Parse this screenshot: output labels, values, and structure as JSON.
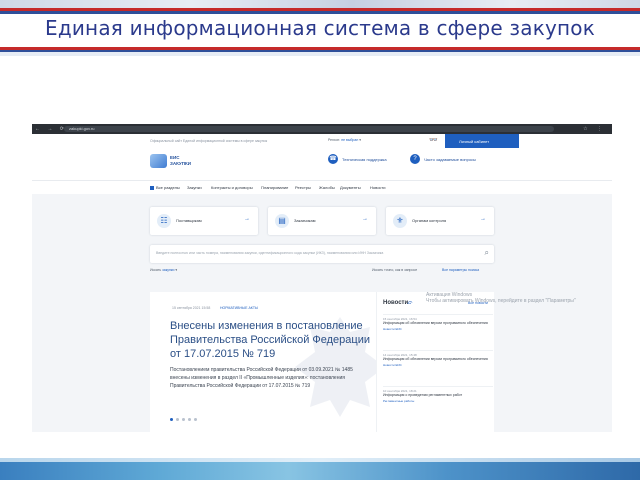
{
  "slide": {
    "title": "Единая информационная система в сфере закупок"
  },
  "browser": {
    "url": "zakupki.gov.ru",
    "nav_icons": "← → ⟳ ⌂",
    "right_icons": "☆ ⋮"
  },
  "site": {
    "top_caption": "Официальный сайт Единой информационной системы в сфере закупок",
    "region_label": "Регион",
    "region_value": "не выбран",
    "glasses_icon": "👓",
    "cabinet_label": "Личный кабинет",
    "logo_line1": "ЕИС",
    "logo_line2": "ЗАКУПКИ",
    "support_label": "Техническая поддержка",
    "faq_label": "Часто задаваемые вопросы",
    "menu": [
      "Все разделы",
      "Закупки",
      "Контракты и договоры",
      "Планирование",
      "Реестры",
      "Жалобы",
      "Документы",
      "Новости"
    ],
    "cards": [
      {
        "label": "Поставщикам",
        "icon": "☷"
      },
      {
        "label": "Заказчикам",
        "icon": "▤"
      },
      {
        "label": "Органам контроля",
        "icon": "⚜"
      }
    ],
    "search_placeholder": "Введите полностью или часть номера, наименования закупки, идентификационного кода закупки (ИКЗ), наименования или ИНН Заказчика",
    "search_icon": "⌕",
    "filter_scope_label": "Искать",
    "filter_scope_value": "закупки",
    "filter_exact": "Искать точно, как в запросе",
    "filter_advanced": "Все параметры поиска",
    "banner": {
      "date": "15 сентября 2021 15:58",
      "tag": "НОРМАТИВНЫЕ АКТЫ",
      "headline": "Внесены изменения в постановление Правительства Российской Федерации от 17.07.2015 № 719",
      "body": "Постановлением правительства Российской Федерации от 03.09.2021 № 1485 внесены изменения в раздел II «Промышленные изделия»: постановления Правительства Российской Федерации от 17.07.2015 № 719"
    },
    "news_title": "Новости",
    "news_rss": "⤽",
    "news_all": "Все новости",
    "news_items": [
      {
        "date": "15 сентября 2021, 16:54",
        "text": "Информация об обновлении версии программного обеспечения",
        "cat": "Новости ЕИС"
      },
      {
        "date": "14 сентября 2021, 15:48",
        "text": "Информация об обновлении версии программного обеспечения",
        "cat": "Новости ЕИС"
      },
      {
        "date": "10 сентября 2021, 18:21",
        "text": "Информация о проведении регламентных работ",
        "cat": "Регламентные работы"
      }
    ],
    "activation_line1": "Активация Windows",
    "activation_line2": "Чтобы активировать Windows, перейдите в раздел \"Параметры\""
  }
}
